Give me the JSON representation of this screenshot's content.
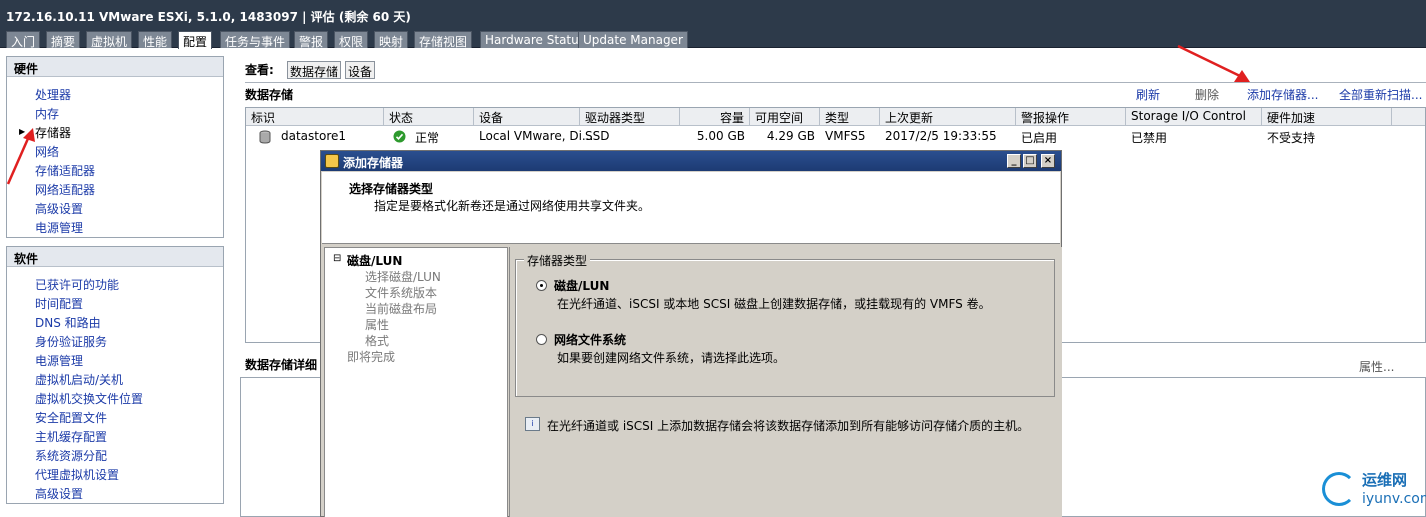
{
  "window_title": "172.16.10.11 VMware ESXi, 5.1.0, 1483097 | 评估 (剩余 60 天)",
  "tabs": [
    {
      "label": "入门"
    },
    {
      "label": "摘要"
    },
    {
      "label": "虚拟机"
    },
    {
      "label": "性能"
    },
    {
      "label": "配置"
    },
    {
      "label": "任务与事件"
    },
    {
      "label": "警报"
    },
    {
      "label": "权限"
    },
    {
      "label": "映射"
    },
    {
      "label": "存储视图"
    },
    {
      "label": "Hardware Status"
    },
    {
      "label": "Update Manager"
    }
  ],
  "hardware": {
    "title": "硬件",
    "items": [
      {
        "label": "处理器"
      },
      {
        "label": "内存"
      },
      {
        "label": "存储器"
      },
      {
        "label": "网络"
      },
      {
        "label": "存储适配器"
      },
      {
        "label": "网络适配器"
      },
      {
        "label": "高级设置"
      },
      {
        "label": "电源管理"
      }
    ]
  },
  "software": {
    "title": "软件",
    "items": [
      {
        "label": "已获许可的功能"
      },
      {
        "label": "时间配置"
      },
      {
        "label": "DNS 和路由"
      },
      {
        "label": "身份验证服务"
      },
      {
        "label": "电源管理"
      },
      {
        "label": "虚拟机启动/关机"
      },
      {
        "label": "虚拟机交换文件位置"
      },
      {
        "label": "安全配置文件"
      },
      {
        "label": "主机缓存配置"
      },
      {
        "label": "系统资源分配"
      },
      {
        "label": "代理虚拟机设置"
      },
      {
        "label": "高级设置"
      }
    ]
  },
  "view": {
    "label": "查看:",
    "opt1": "数据存储",
    "opt2": "设备"
  },
  "datastores": {
    "title": "数据存储",
    "actions": {
      "refresh": "刷新",
      "delete": "删除",
      "add": "添加存储器...",
      "rescan": "全部重新扫描..."
    },
    "columns": [
      "标识",
      "状态",
      "设备",
      "驱动器类型",
      "容量",
      "可用空间",
      "类型",
      "上次更新",
      "警报操作",
      "Storage I/O Control",
      "硬件加速"
    ],
    "row": {
      "name": "datastore1",
      "status": "正常",
      "device": "Local VMware, Di...",
      "drive_type": "SSD",
      "capacity": "5.00 GB",
      "free": "4.29 GB",
      "type": "VMFS5",
      "updated": "2017/2/5 19:33:55",
      "alarm": "已启用",
      "sioc": "已禁用",
      "hw_accel": "不受支持"
    }
  },
  "details": {
    "title": "数据存储详细",
    "props": "属性..."
  },
  "dialog": {
    "title": "添加存储器",
    "header_title": "选择存储器类型",
    "header_desc": "指定是要格式化新卷还是通过网络使用共享文件夹。",
    "steps": [
      {
        "label": "磁盘/LUN"
      },
      {
        "label": "选择磁盘/LUN"
      },
      {
        "label": "文件系统版本"
      },
      {
        "label": "当前磁盘布局"
      },
      {
        "label": "属性"
      },
      {
        "label": "格式"
      },
      {
        "label": "即将完成"
      }
    ],
    "group_label": "存储器类型",
    "opt1_title": "磁盘/LUN",
    "opt1_desc": "在光纤通道、iSCSI 或本地 SCSI 磁盘上创建数据存储，或挂载现有的 VMFS 卷。",
    "opt2_title": "网络文件系统",
    "opt2_desc": "如果要创建网络文件系统，请选择此选项。",
    "info": "在光纤通道或 iSCSI 上添加数据存储会将该数据存储添加到所有能够访问存储介质的主机。",
    "selected_option": "磁盘/LUN"
  },
  "watermark": {
    "t1": "运维网",
    "t2": "iyunv.com"
  },
  "colors": {
    "titlebar": "#2d3a4a",
    "link": "#1c3ba8",
    "dialog_title": "#1d3b73",
    "annotation": "#e02020"
  }
}
